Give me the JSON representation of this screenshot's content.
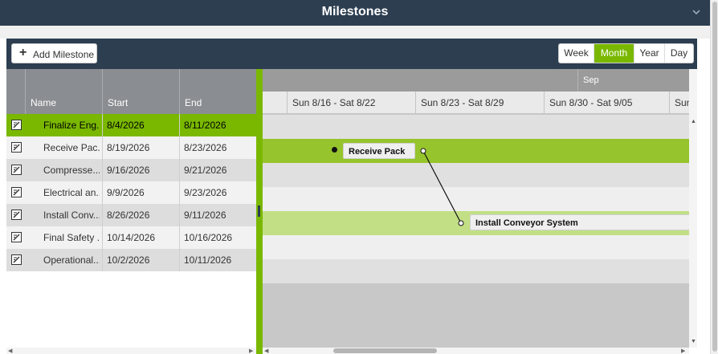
{
  "window": {
    "title": "Milestones"
  },
  "toolbar": {
    "add_label": "Add Milestone",
    "views": [
      "Week",
      "Month",
      "Year",
      "Day"
    ],
    "active_view": "Month"
  },
  "grid": {
    "columns": {
      "name": "Name",
      "start": "Start",
      "end": "End"
    },
    "rows": [
      {
        "name": "Finalize Eng...",
        "start": "8/4/2026",
        "end": "8/11/2026"
      },
      {
        "name": "Receive Pac...",
        "start": "8/19/2026",
        "end": "8/23/2026"
      },
      {
        "name": "Compresse...",
        "start": "9/16/2026",
        "end": "9/21/2026"
      },
      {
        "name": "Electrical an...",
        "start": "9/9/2026",
        "end": "9/23/2026"
      },
      {
        "name": "Install Conv...",
        "start": "8/26/2026",
        "end": "9/11/2026"
      },
      {
        "name": "Final Safety ...",
        "start": "10/14/2026",
        "end": "10/16/2026"
      },
      {
        "name": "Operational...",
        "start": "10/2/2026",
        "end": "10/11/2026"
      }
    ]
  },
  "timeline": {
    "month_label": "Sep",
    "weeks": [
      "Sun 8/16 - Sat 8/22",
      "Sun 8/23 - Sat 8/29",
      "Sun 8/30 - Sat 9/05",
      "Sun"
    ],
    "bars": [
      {
        "label": "Receive Pack"
      },
      {
        "label": "Install Conveyor System"
      }
    ]
  },
  "colors": {
    "header": "#2c3e50",
    "accent": "#7ab800"
  }
}
